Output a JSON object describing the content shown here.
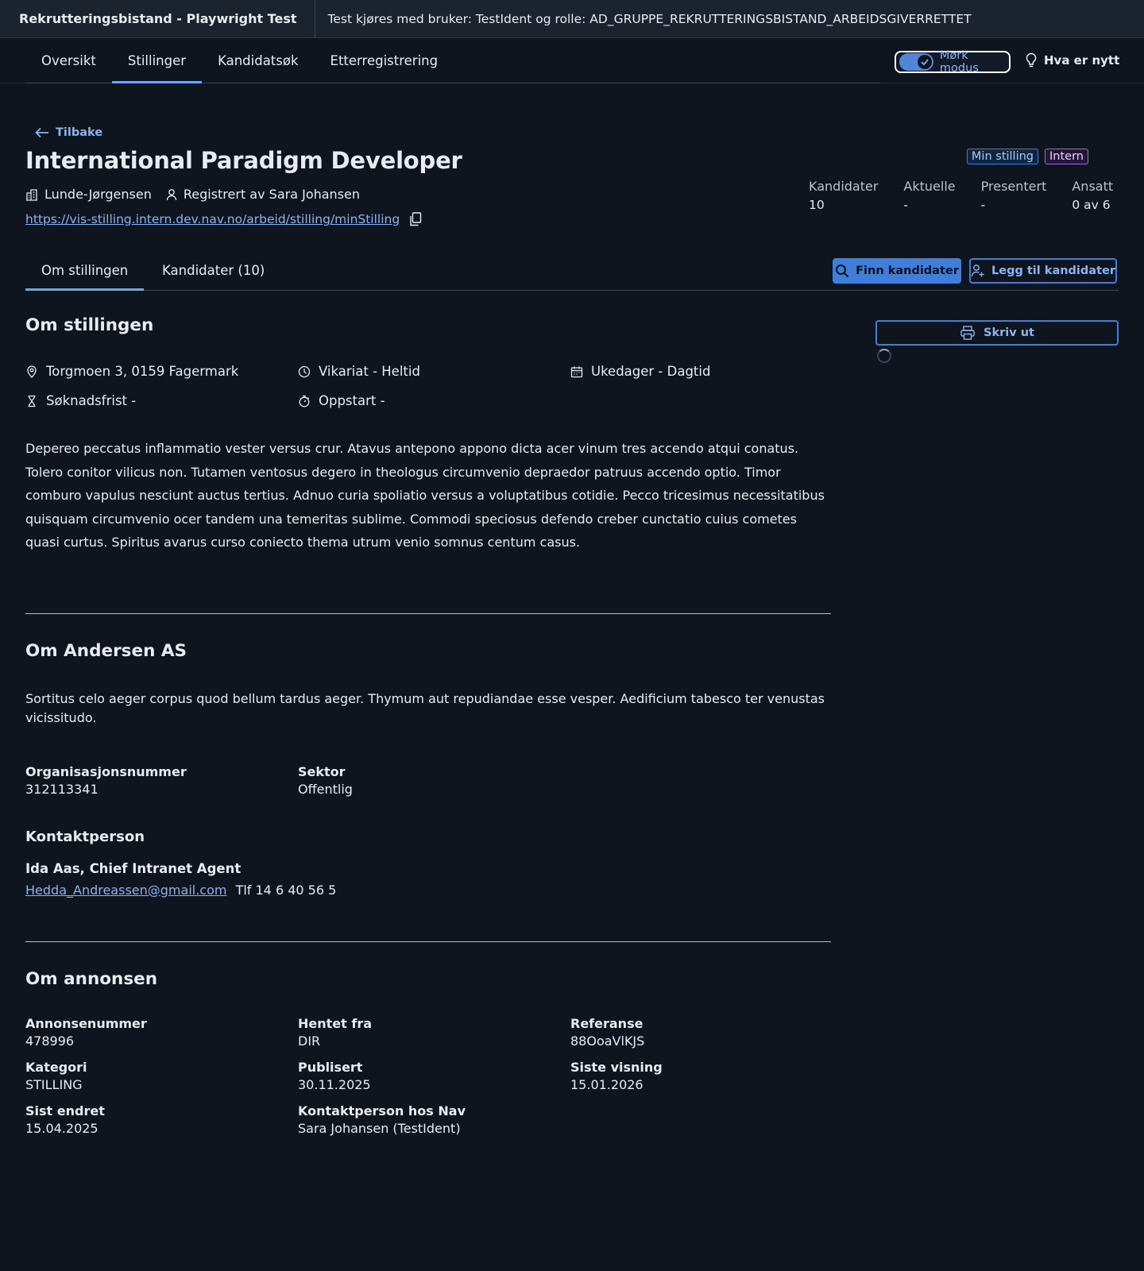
{
  "topbar": {
    "app_title": "Rekrutteringsbistand - Playwright Test",
    "test_info": "Test kjøres med bruker: TestIdent og rolle: AD_GRUPPE_REKRUTTERINGSBISTAND_ARBEIDSGIVERRETTET"
  },
  "nav": {
    "tabs": [
      {
        "label": "Oversikt"
      },
      {
        "label": "Stillinger",
        "active": true
      },
      {
        "label": "Kandidatsøk"
      },
      {
        "label": "Etterregistrering"
      }
    ],
    "dark_mode_label": "Mørk modus",
    "dark_mode_on": true,
    "whats_new": "Hva er nytt"
  },
  "header": {
    "back": "Tilbake",
    "title": "International Paradigm Developer",
    "employer": "Lunde-Jørgensen",
    "registered_by": "Registrert av Sara Johansen",
    "url": "https://vis-stilling.intern.dev.nav.no/arbeid/stilling/minStilling",
    "badges": [
      "Min stilling",
      "Intern"
    ],
    "stats": [
      {
        "label": "Kandidater",
        "value": "10"
      },
      {
        "label": "Aktuelle",
        "value": "-"
      },
      {
        "label": "Presentert",
        "value": "-"
      },
      {
        "label": "Ansatt",
        "value": "0 av 6"
      }
    ]
  },
  "sub_tabs": [
    {
      "label": "Om stillingen",
      "active": true
    },
    {
      "label": "Kandidater (10)"
    }
  ],
  "actions": {
    "find": "Finn kandidater",
    "add": "Legg til kandidater",
    "print": "Skriv ut"
  },
  "about_position": {
    "heading": "Om stillingen",
    "address": "Torgmoen 3, 0159 Fagermark",
    "employment": "Vikariat - Heltid",
    "workdays": "Ukedager - Dagtid",
    "deadline": "Søknadsfrist -",
    "start": "Oppstart -",
    "description": "Depereo peccatus inflammatio vester versus crur. Atavus antepono appono dicta acer vinum tres accendo atqui conatus. Tolero conitor vilicus non. Tutamen ventosus degero in theologus circumvenio depraedor patruus accendo optio. Timor comburo vapulus nesciunt auctus tertius. Adnuo curia spoliatio versus a voluptatibus cotidie. Pecco tricesimus necessitatibus quisquam circumvenio ocer tandem una temeritas sublime. Commodi speciosus defendo creber cunctatio cuius cometes quasi curtus. Spiritus avarus curso coniecto thema utrum venio somnus centum casus."
  },
  "about_employer": {
    "heading": "Om Andersen AS",
    "description": "Sortitus celo aeger corpus quod bellum tardus aeger. Thymum aut repudiandae esse vesper. Aedificium tabesco ter venustas vicissitudo.",
    "org_label": "Organisasjonsnummer",
    "org_value": "312113341",
    "sector_label": "Sektor",
    "sector_value": "Offentlig",
    "contact_heading": "Kontaktperson",
    "contact_name": "Ida Aas, Chief Intranet Agent",
    "contact_email": "Hedda_Andreassen@gmail.com",
    "contact_phone": "Tlf 14 6 40 56 5"
  },
  "about_ad": {
    "heading": "Om annonsen",
    "fields": [
      {
        "label": "Annonsenummer",
        "value": "478996"
      },
      {
        "label": "Hentet fra",
        "value": "DIR"
      },
      {
        "label": "Referanse",
        "value": "88OoaVlKJS"
      },
      {
        "label": "Kategori",
        "value": "STILLING"
      },
      {
        "label": "Publisert",
        "value": "30.11.2025"
      },
      {
        "label": "Siste visning",
        "value": "15.01.2026"
      },
      {
        "label": "Sist endret",
        "value": "15.04.2025"
      },
      {
        "label": "Kontaktperson hos Nav",
        "value": "Sara Johansen (TestIdent)"
      }
    ]
  },
  "colors": {
    "background": "#0e151f",
    "accent": "#3f7edb",
    "link": "#8ab4f0"
  }
}
